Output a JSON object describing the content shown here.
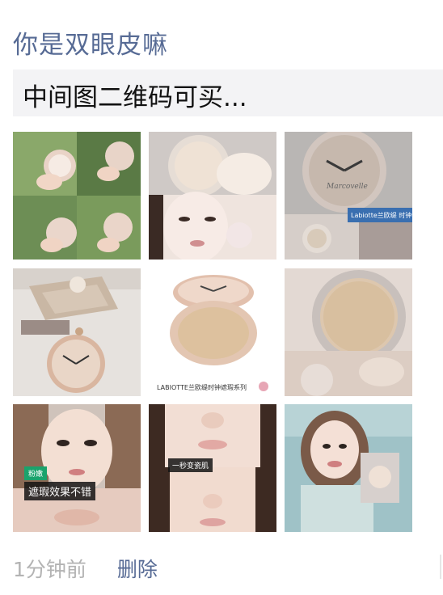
{
  "post": {
    "author": "你是双眼皮嘛",
    "link_text": "中间图二维码可买...",
    "time": "1分钟前",
    "delete_label": "删除"
  },
  "photos": {
    "p6_caption": "LABIOTTE兰欧缇时钟遮瑕系列",
    "p6_brand": "Labiotte兰欧缇 时钟气垫",
    "p8_caption": "一秒变瓷肌",
    "p7_caption1": "粉嫩",
    "p7_caption2": "遮瑕效果不错",
    "logo_script": "Marcovelle"
  }
}
